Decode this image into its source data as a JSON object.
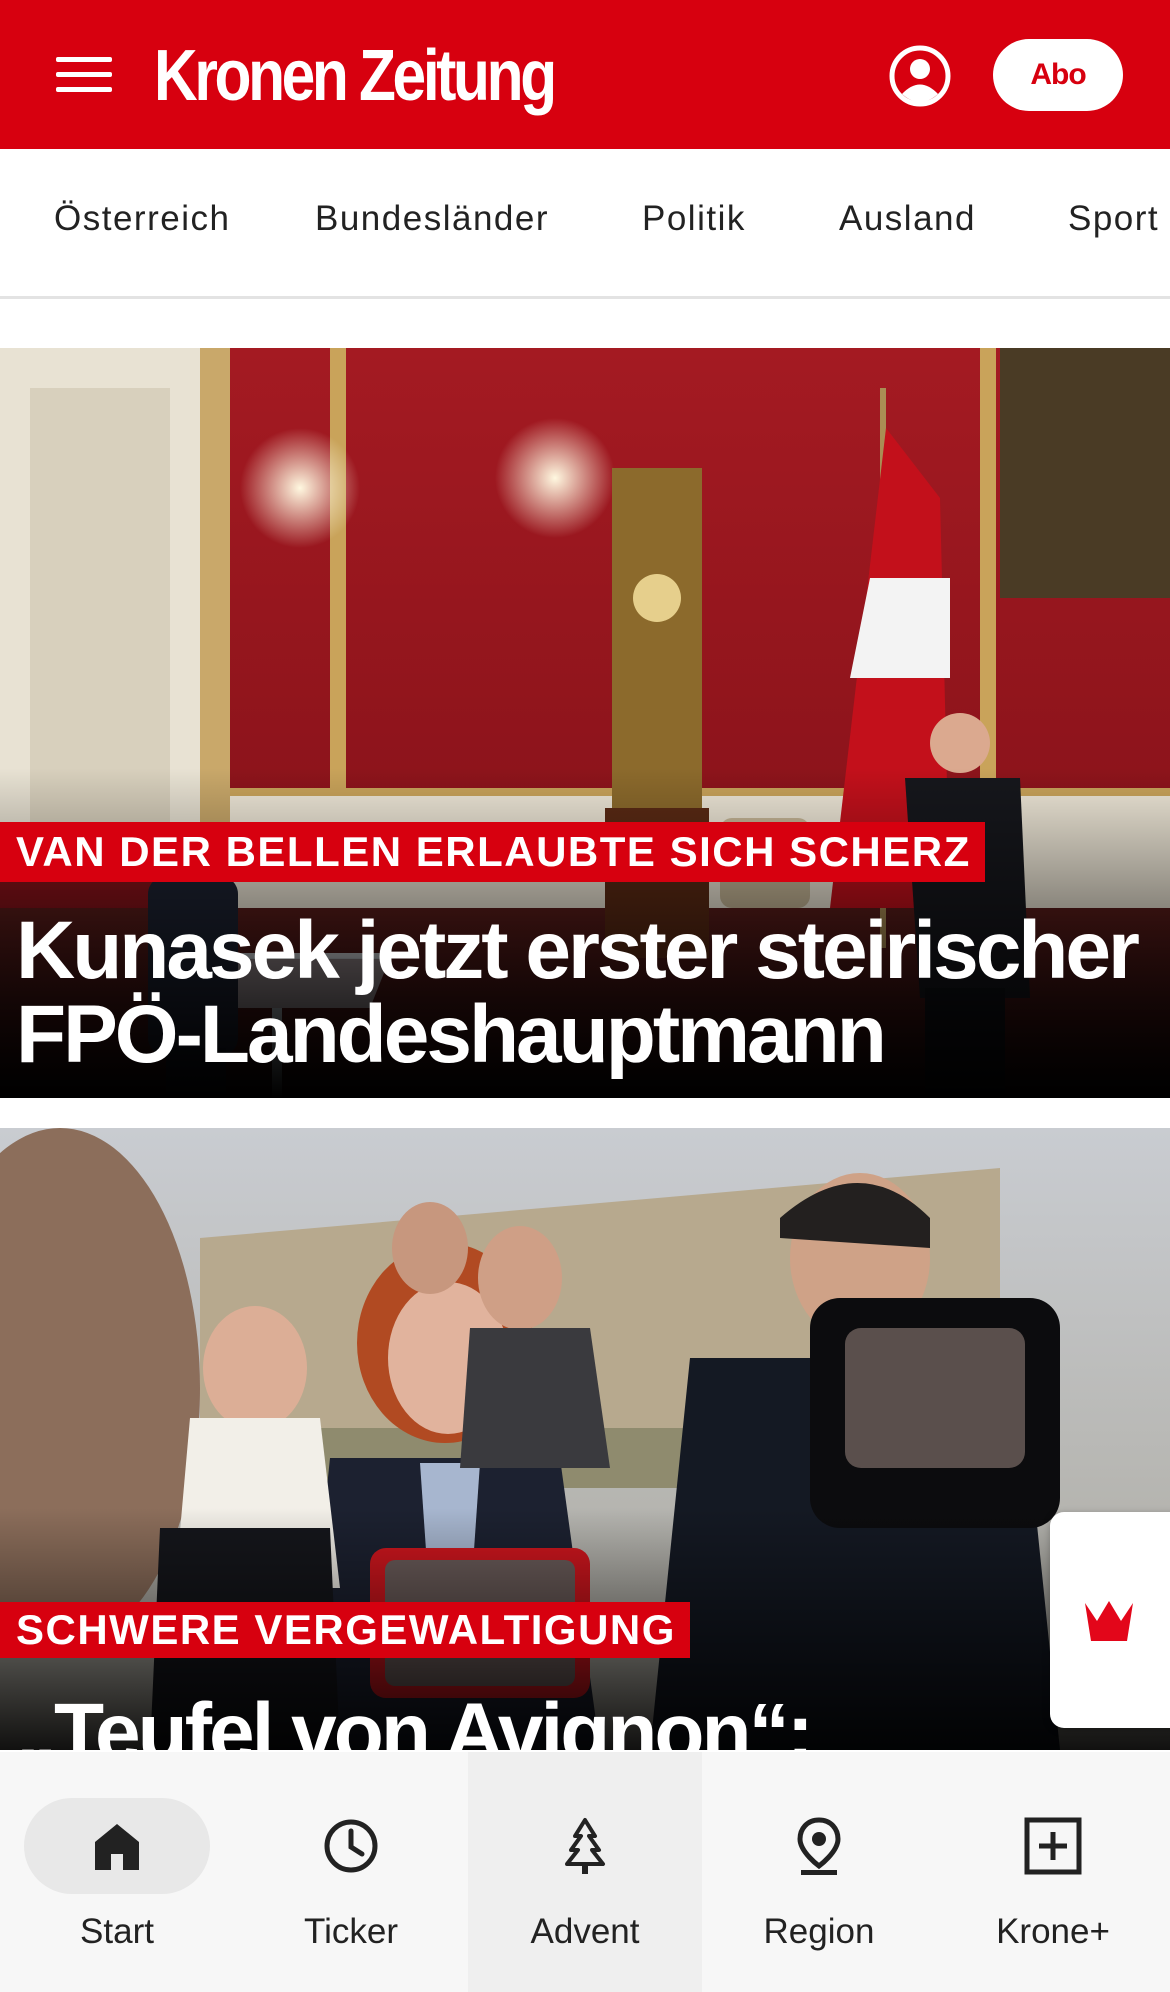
{
  "header": {
    "logo": "Kronen Zeitung",
    "abo_label": "Abo",
    "menu_icon": "hamburger-menu-icon",
    "account_icon": "user-account-icon",
    "brand_color": "#d7000f"
  },
  "nav": {
    "items": [
      {
        "label": "Österreich"
      },
      {
        "label": "Bundesländer"
      },
      {
        "label": "Politik"
      },
      {
        "label": "Ausland"
      },
      {
        "label": "Sport"
      }
    ]
  },
  "stories": [
    {
      "kicker": "VAN DER BELLEN ERLAUBTE SICH SCHERZ",
      "headline_line1": "Kunasek jetzt erster steirischer",
      "headline_line2": "FPÖ-Landeshauptmann"
    },
    {
      "kicker": "SCHWERE VERGEWALTIGUNG",
      "headline_line1": "„Teufel von Avignon“:"
    }
  ],
  "krone_widget": {
    "icon": "krone-crown-icon"
  },
  "bottom_nav": {
    "items": [
      {
        "label": "Start",
        "icon": "home-icon",
        "active": true
      },
      {
        "label": "Ticker",
        "icon": "clock-icon"
      },
      {
        "label": "Advent",
        "icon": "tree-icon"
      },
      {
        "label": "Region",
        "icon": "location-pin-icon"
      },
      {
        "label": "Krone+",
        "icon": "plus-box-icon"
      }
    ]
  }
}
